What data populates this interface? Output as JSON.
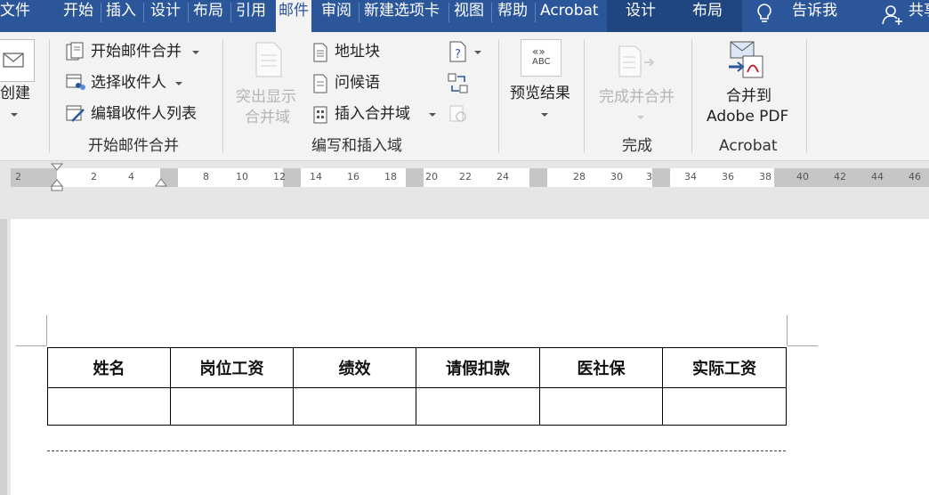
{
  "tabs": {
    "file": "文件",
    "home": "开始",
    "insert": "插入",
    "design": "设计",
    "layout": "布局",
    "references": "引用",
    "mailings": "邮件",
    "review": "审阅",
    "newtab": "新建选项卡",
    "view": "视图",
    "help": "帮助",
    "acrobat": "Acrobat",
    "ctx_design": "设计",
    "ctx_layout": "布局",
    "tellme": "告诉我",
    "share": "共享"
  },
  "ribbon": {
    "create_label": "创建",
    "start_merge_btn": "开始邮件合并",
    "select_recipients_btn": "选择收件人",
    "edit_list_btn": "编辑收件人列表",
    "group_start": "开始邮件合并",
    "highlight_line1": "突出显示",
    "highlight_line2": "合并域",
    "address_block": "地址块",
    "greeting_line": "问候语",
    "insert_field": "插入合并域",
    "group_write": "编写和插入域",
    "preview_results": "预览结果",
    "preview_icon_text": "ABC",
    "finish_merge": "完成并合并",
    "group_finish": "完成",
    "merge_pdf_line1": "合并到",
    "merge_pdf_line2": "Adobe PDF",
    "group_acrobat": "Acrobat"
  },
  "ruler": {
    "marks": [
      "2",
      "2",
      "4",
      "8",
      "10",
      "12",
      "14",
      "16",
      "18",
      "20",
      "22",
      "24",
      "28",
      "30",
      "3",
      "34",
      "36",
      "38",
      "40",
      "42",
      "44",
      "46"
    ]
  },
  "table": {
    "headers": [
      "姓名",
      "岗位工资",
      "绩效",
      "请假扣款",
      "医社保",
      "实际工资"
    ]
  },
  "colors": {
    "tabbar": "#2b579a",
    "ribbon": "#f3f3f3",
    "canvas": "#e6e6e6"
  }
}
